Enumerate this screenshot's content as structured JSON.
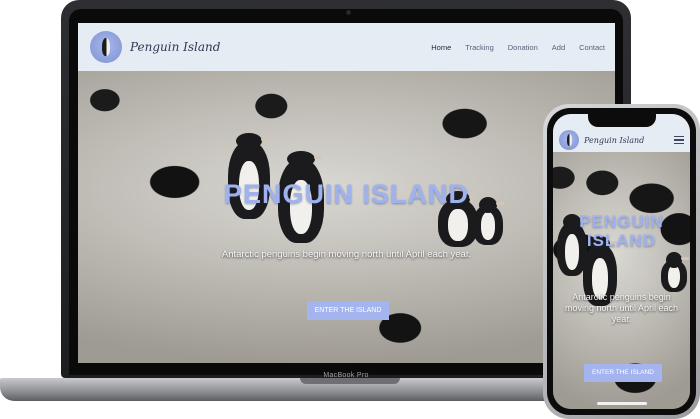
{
  "device_labels": {
    "laptop_model": "MacBook Pro"
  },
  "site": {
    "brand": "Penguin Island",
    "nav": {
      "items": [
        {
          "label": "Home",
          "active": true
        },
        {
          "label": "Tracking",
          "active": false
        },
        {
          "label": "Donation",
          "active": false
        },
        {
          "label": "Add",
          "active": false
        },
        {
          "label": "Contact",
          "active": false
        }
      ]
    },
    "hero": {
      "title": "PENGUIN ISLAND",
      "subtitle": "Antarctic penguins begin moving north until April each year.",
      "button_label": "ENTER THE ISLAND"
    },
    "icons": {
      "logo": "penguin-logo-icon",
      "menu": "hamburger-menu-icon"
    },
    "colors": {
      "accent": "#a3b4ee",
      "title": "#9fb2ee",
      "nav_bg": "#e6ecf3"
    }
  }
}
